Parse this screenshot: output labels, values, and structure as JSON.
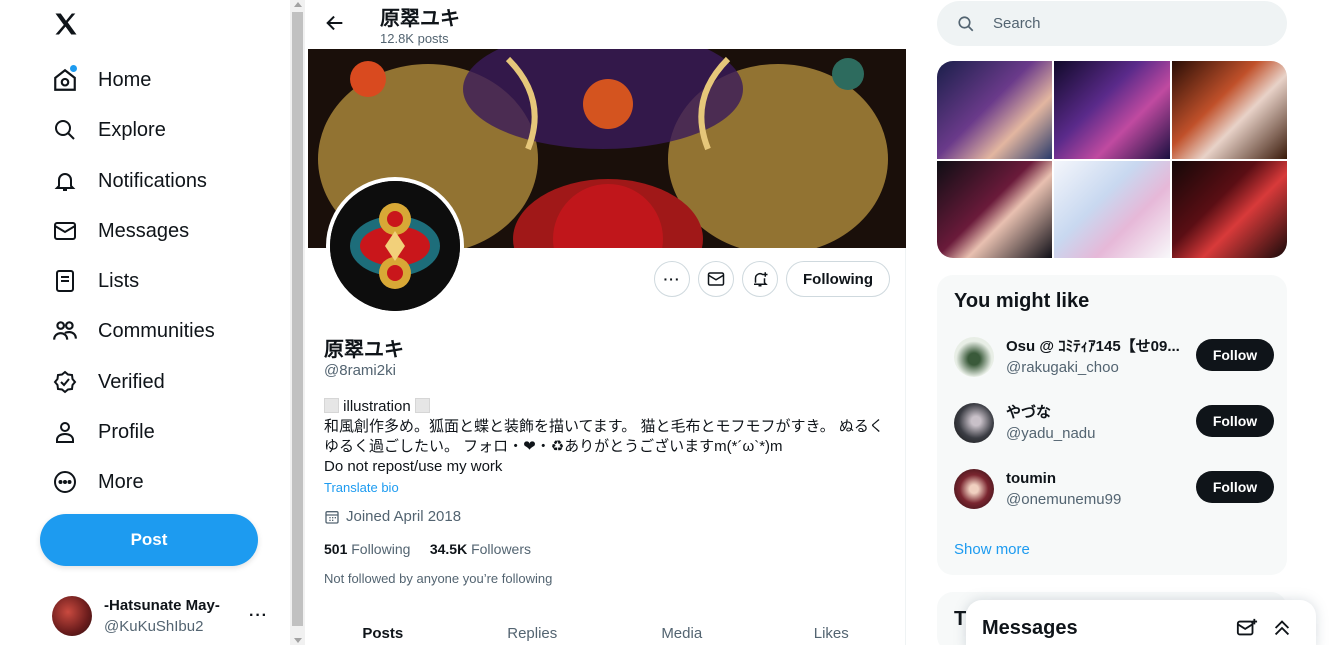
{
  "nav": {
    "items": [
      {
        "label": "Home",
        "icon": "home-icon"
      },
      {
        "label": "Explore",
        "icon": "search-icon"
      },
      {
        "label": "Notifications",
        "icon": "bell-icon"
      },
      {
        "label": "Messages",
        "icon": "envelope-icon"
      },
      {
        "label": "Lists",
        "icon": "list-icon"
      },
      {
        "label": "Communities",
        "icon": "communities-icon"
      },
      {
        "label": "Verified",
        "icon": "verified-icon"
      },
      {
        "label": "Profile",
        "icon": "person-icon"
      },
      {
        "label": "More",
        "icon": "more-circle-icon"
      }
    ],
    "post_label": "Post",
    "account": {
      "name": "-Hatsunate May-",
      "handle": "@KuKuShIbu2",
      "more": "···"
    }
  },
  "header": {
    "title": "原翠ユキ",
    "posts": "12.8K posts"
  },
  "profile": {
    "name": "原翠ユキ",
    "handle": "@8rami2ki",
    "following_btn": "Following",
    "bio_line1_text": "illustration",
    "bio_line2": "和風創作多め。狐面と蝶と装飾を描いてます。 猫と毛布とモフモフがすき。 ぬるく",
    "bio_line3": "ゆるく過ごしたい。 フォロ・❤・♻ありがとうございますm(*´ω`*)m",
    "bio_line4": "Do not repost/use my work",
    "translate": "Translate bio",
    "joined": "Joined April 2018",
    "following_count": "501",
    "following_label": "Following",
    "followers_count": "34.5K",
    "followers_label": "Followers",
    "not_followed": "Not followed by anyone you’re following"
  },
  "tabs": [
    "Posts",
    "Replies",
    "Media",
    "Likes"
  ],
  "search": {
    "placeholder": "Search"
  },
  "wtf": {
    "title": "You might like",
    "users": [
      {
        "name": "Osu @ ｺﾐﾃｨｱ145【せ09...",
        "handle": "@rakugaki_choo",
        "button": "Follow",
        "color": "#e8eee6"
      },
      {
        "name": "やづな",
        "handle": "@yadu_nadu",
        "button": "Follow",
        "color": "#3b3d44"
      },
      {
        "name": "toumin",
        "handle": "@onemunemu99",
        "button": "Follow",
        "color": "#7a2630"
      }
    ],
    "show_more": "Show more"
  },
  "trends": {
    "title_visible": "T"
  },
  "messages_dock": {
    "title": "Messages"
  },
  "colors": {
    "accent": "#1d9bf0",
    "text": "#0f1419",
    "muted": "#536471"
  }
}
